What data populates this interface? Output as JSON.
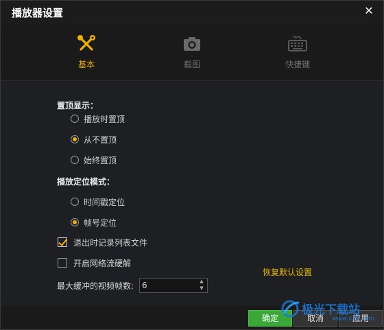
{
  "window": {
    "title": "播放器设置",
    "close_symbol": "✕"
  },
  "tabs": [
    {
      "label": "基本",
      "icon": "tools-icon",
      "active": true
    },
    {
      "label": "截图",
      "icon": "camera-icon",
      "active": false
    },
    {
      "label": "快捷键",
      "icon": "keyboard-icon",
      "active": false
    }
  ],
  "pin": {
    "title": "置顶显示：",
    "options": [
      "播放时置顶",
      "从不置顶",
      "始终置顶"
    ],
    "selected": "从不置顶"
  },
  "seek": {
    "title": "播放定位模式：",
    "options": [
      "时间戳定位",
      "帧号定位"
    ],
    "selected": "帧号定位"
  },
  "checks": {
    "record_on_exit": {
      "label": "退出时记录列表文件",
      "checked": true
    },
    "hw_decode": {
      "label": "开启网络流硬解",
      "checked": false
    }
  },
  "restore_defaults": "恢复默认设置",
  "buffer": {
    "label": "最大缓冲的视频帧数:",
    "value": "6"
  },
  "footer": {
    "ok": "确定",
    "cancel": "取消",
    "apply": "应用"
  },
  "watermark": {
    "text": "极光下载站",
    "sub": "www.xz7.com"
  },
  "colors": {
    "accent": "#f0b000",
    "primary_button": "#3aa838",
    "watermark": "#1a77d2"
  }
}
